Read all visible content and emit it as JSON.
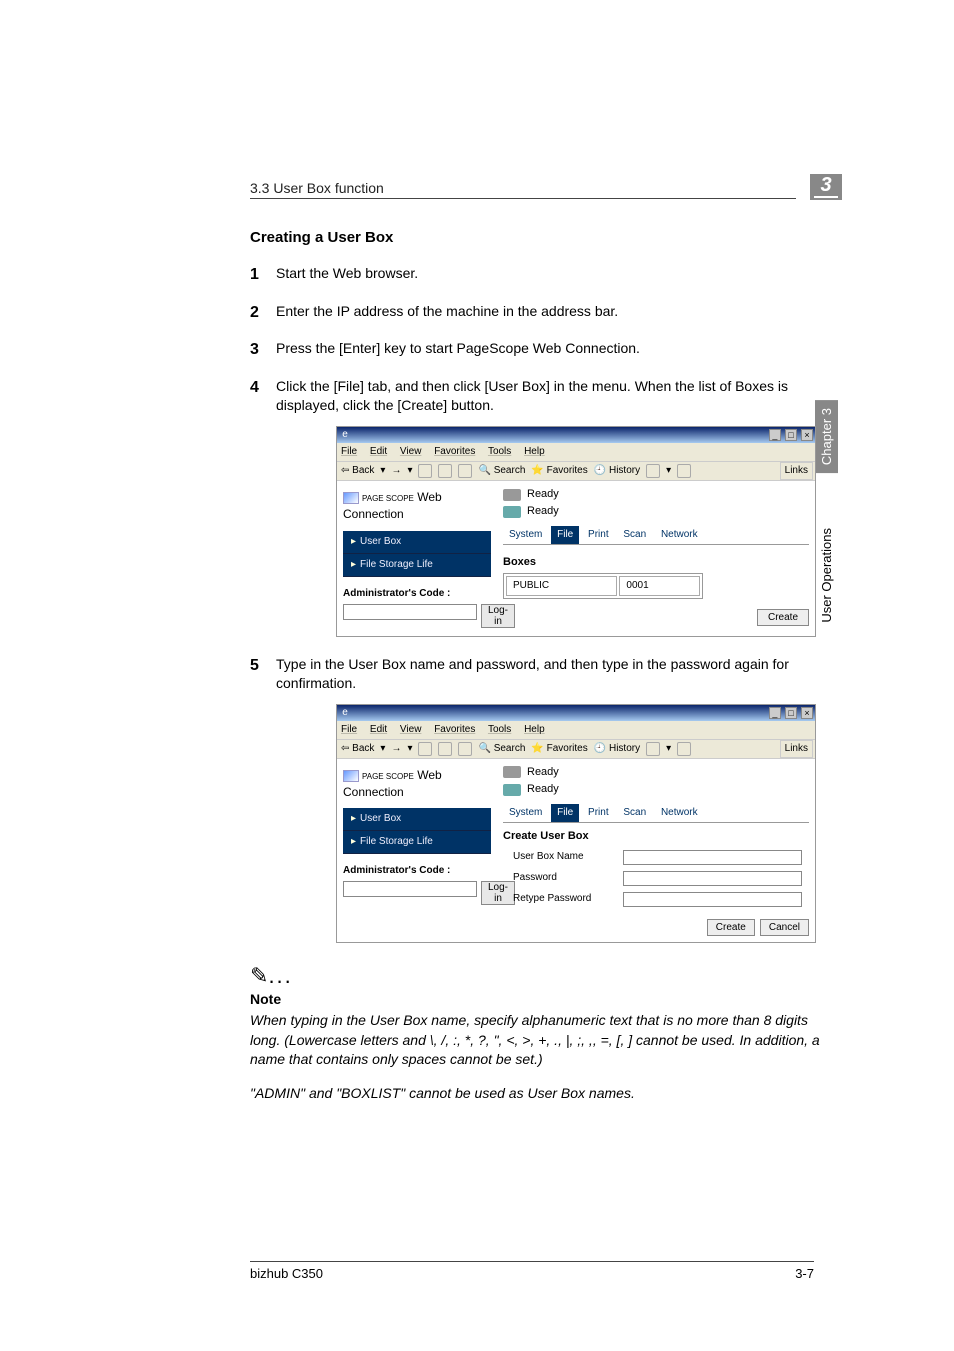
{
  "header": {
    "section": "3.3 User Box function"
  },
  "chapter": {
    "num": "3",
    "vertical_chapter": "Chapter 3",
    "vertical_user": "User Operations"
  },
  "subhead": "Creating a User Box",
  "steps": [
    {
      "n": "1",
      "text": "Start the Web browser."
    },
    {
      "n": "2",
      "text": "Enter the IP address of the machine in the address bar."
    },
    {
      "n": "3",
      "text": "Press the [Enter] key to start PageScope Web Connection."
    },
    {
      "n": "4",
      "text": "Click the [File] tab, and then click [User Box] in the menu. When the list of Boxes is displayed, click the [Create] button."
    },
    {
      "n": "5",
      "text": "Type in the User Box name and password, and then type in the password again for confirmation."
    }
  ],
  "ie": {
    "menus": {
      "file": "File",
      "edit": "Edit",
      "view": "View",
      "favorites": "Favorites",
      "tools": "Tools",
      "help": "Help"
    },
    "toolbar": {
      "back": "Back",
      "search": "Search",
      "favorites": "Favorites",
      "history": "History"
    },
    "links": "Links"
  },
  "ps": {
    "brand_top": "PAGE SCOPE",
    "brand": "Web Connection",
    "ready": "Ready",
    "tabs": {
      "system": "System",
      "file": "File",
      "print": "Print",
      "scan": "Scan",
      "network": "Network"
    },
    "nav": {
      "userbox": "User Box",
      "storage": "File Storage Life"
    },
    "admin_label": "Administrator's Code :",
    "login_btn": "Log-in",
    "boxes_label": "Boxes",
    "box_row": {
      "name": "PUBLIC",
      "num": "0001"
    },
    "create": "Create",
    "form_heading": "Create User Box",
    "fields": {
      "name": "User Box Name",
      "password": "Password",
      "retype": "Retype Password"
    },
    "cancel": "Cancel"
  },
  "note": {
    "head": "Note",
    "body1": "When typing in the User Box name, specify alphanumeric text that is no more than 8 digits long. (Lowercase letters and \\, /, :, *, ?, \", <, >, +, ., |, ;, ,, =, [, ] cannot be used. In addition, a name that contains only spaces cannot be set.)",
    "body2": "\"ADMIN\" and \"BOXLIST\" cannot be used as User Box names."
  },
  "footer": {
    "left": "bizhub C350",
    "right": "3-7"
  }
}
